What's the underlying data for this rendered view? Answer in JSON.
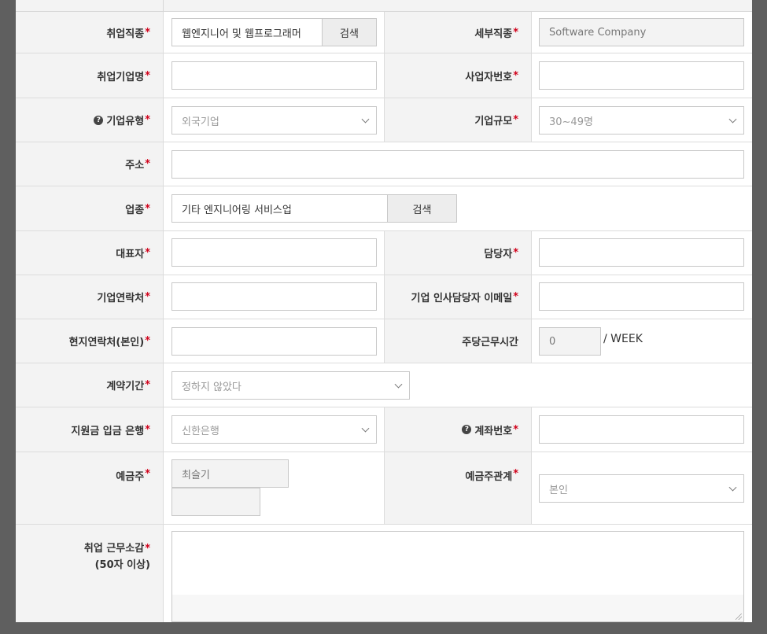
{
  "form": {
    "job_type": {
      "label": "취업직종",
      "value": "웹엔지니어 및 웹프로그래머",
      "button": "검색"
    },
    "job_detail": {
      "label": "세부직종",
      "value": "Software Company"
    },
    "company_name": {
      "label": "취업기업명",
      "value": ""
    },
    "business_number": {
      "label": "사업자번호",
      "value": ""
    },
    "company_type": {
      "label": "기업유형",
      "value": "외국기업"
    },
    "company_size": {
      "label": "기업규모",
      "value": "30~49명"
    },
    "address": {
      "label": "주소",
      "value": ""
    },
    "industry": {
      "label": "업종",
      "value": "기타 엔지니어링 서비스업",
      "button": "검색"
    },
    "ceo": {
      "label": "대표자",
      "value": ""
    },
    "manager": {
      "label": "담당자",
      "value": ""
    },
    "company_contact": {
      "label": "기업연락처",
      "value": ""
    },
    "hr_email": {
      "label": "기업 인사담당자 이메일",
      "value": ""
    },
    "local_contact": {
      "label": "현지연락처(본인)",
      "value": ""
    },
    "weekly_hours": {
      "label": "주당근무시간",
      "value": "0",
      "unit": "/ WEEK"
    },
    "contract_period": {
      "label": "계약기간",
      "value": "정하지 않았다"
    },
    "bank": {
      "label": "지원금 입금 은행",
      "value": "신한은행"
    },
    "account_number": {
      "label": "계좌번호",
      "value": ""
    },
    "account_holder": {
      "label": "예금주",
      "value": "최슬기"
    },
    "holder_relation": {
      "label": "예금주관계",
      "value": "본인"
    },
    "impression": {
      "label_line1": "취업 근무소감",
      "label_line2": "(50자 이상)"
    },
    "required_mark": "*"
  },
  "icons": {
    "help": "question-circle-icon",
    "dropdown": "chevron-down-icon",
    "resize": "resize-grip-icon"
  },
  "colors": {
    "required": "#d0021b",
    "label_bg": "#f3f3f3",
    "border": "#dcdcdc",
    "backdrop": "#5f5f5f"
  }
}
